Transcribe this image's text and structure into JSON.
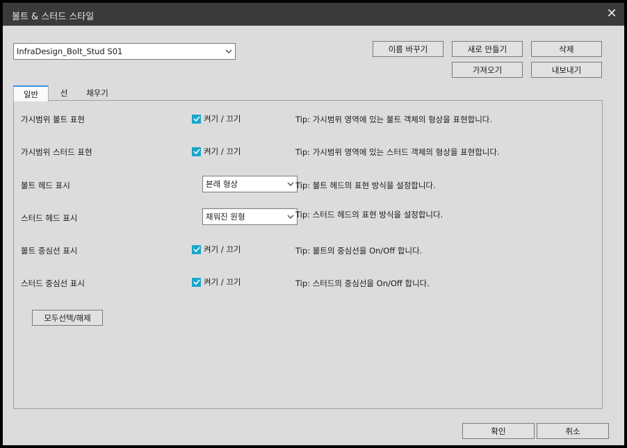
{
  "window": {
    "title": "볼트 & 스터드 스타일",
    "close_icon": "close-icon"
  },
  "style_select": {
    "value": "InfraDesign_Bolt_Stud S01"
  },
  "toolbar": {
    "rename_label": "이름 바꾸기",
    "new_label": "새로 만들기",
    "delete_label": "삭제",
    "import_label": "가져오기",
    "export_label": "내보내기"
  },
  "tabs": [
    {
      "label": "일반",
      "active": true
    },
    {
      "label": "선",
      "active": false
    },
    {
      "label": "채우기",
      "active": false
    }
  ],
  "rows": [
    {
      "label": "가시범위 볼트 표현",
      "control": "checkbox",
      "checked": true,
      "value": "켜기 / 끄기",
      "tip": "Tip: 가시범위 영역에 있는 볼트 객체의 형상을 표현합니다."
    },
    {
      "label": "가시범위 스터드 표현",
      "control": "checkbox",
      "checked": true,
      "value": "켜기 / 끄기",
      "tip": "Tip: 가시범위 영역에 있는 스터드 객체의 형상을 표현합니다."
    },
    {
      "label": "볼트 헤드 표시",
      "control": "select",
      "value": "본래 형상",
      "tip": "Tip: 볼트 헤드의 표현 방식을 설정합니다."
    },
    {
      "label": "스터드 헤드 표시",
      "control": "select",
      "value": "채워진 원형",
      "tip": "Tip: 스터드 헤드의 표현 방식을 설정합니다."
    },
    {
      "label": "볼트 중심선 표시",
      "control": "checkbox",
      "checked": true,
      "value": "켜기 / 끄기",
      "tip": "Tip: 볼트의 중심선을 On/Off 합니다."
    },
    {
      "label": "스터드 중심선 표시",
      "control": "checkbox",
      "checked": true,
      "value": "켜기 / 끄기",
      "tip": "Tip: 스터드의 중심선을 On/Off 합니다."
    }
  ],
  "select_all_label": "모두선택/해제",
  "footer": {
    "ok_label": "확인",
    "cancel_label": "취소"
  },
  "colors": {
    "checkbox": "#1aa6c9",
    "titlebar": "#3a3a3a",
    "tab_accent": "#3b8ee0"
  }
}
